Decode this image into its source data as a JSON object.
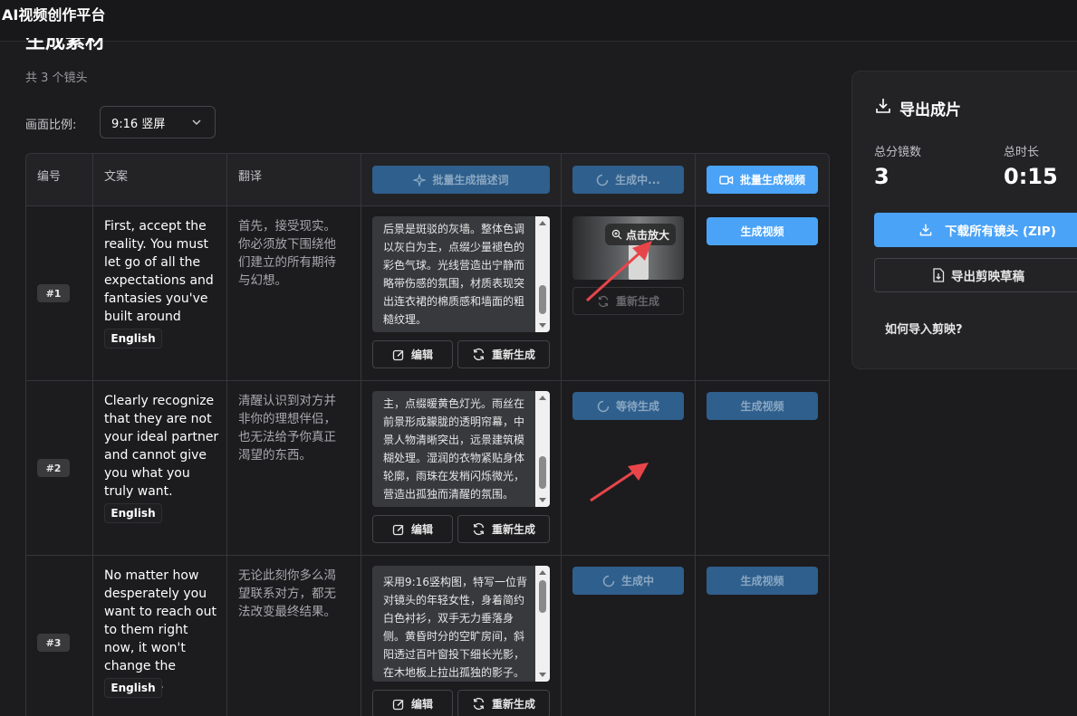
{
  "app": {
    "title": "AI视频创作平台"
  },
  "page": {
    "title": "生成素材",
    "shot_count": "共 3 个镜头"
  },
  "ratio": {
    "label": "画面比例:",
    "value": "9:16 竖屏"
  },
  "table": {
    "headers": {
      "number": "编号",
      "script": "文案",
      "translation": "翻译"
    },
    "batch_prompt_label": "批量生成描述词",
    "batch_generating_label": "生成中...",
    "batch_video_label": "批量生成视频",
    "edit_label": "编辑",
    "regenerate_label": "重新生成",
    "rows": [
      {
        "id": "#1",
        "english": "First, accept the reality. You must let go of all the expectations and fantasies you've built around them.",
        "lang": "English",
        "chinese": "首先，接受现实。你必须放下围绕他们建立的所有期待与幻想。",
        "prompt": "后景是斑驳的灰墙。整体色调以灰白为主，点缀少量褪色的彩色气球。光线营造出宁静而略带伤感的氛围，材质表现突出连衣裙的棉质感和墙面的粗糙纹理。",
        "image_status": "重新生成",
        "zoom_label": "点击放大",
        "video_label": "生成视频"
      },
      {
        "id": "#2",
        "english": "Clearly recognize that they are not your ideal partner and cannot give you what you truly want.",
        "lang": "English",
        "chinese": "清醒认识到对方并非你的理想伴侣，也无法给予你真正渴望的东西。",
        "prompt": "主，点缀暖黄色灯光。雨丝在前景形成朦胧的透明帘幕，中景人物清晰突出，远景建筑模糊处理。湿润的衣物紧贴身体轮廓，雨珠在发梢闪烁微光，营造出孤独而清醒的氛围。",
        "image_status": "等待生成",
        "video_label": "生成视频"
      },
      {
        "id": "#3",
        "english": "No matter how desperately you want to reach out to them right now, it won't change the outcome.",
        "lang": "English",
        "chinese": "无论此刻你多么渴望联系对方，都无法改变最终结果。",
        "prompt": "采用9:16竖构图，特写一位背对镜头的年轻女性，身着简约白色衬衫，双手无力垂落身侧。黄昏时分的空旷房间，斜阳透过百叶窗投下细长光影，在木地板上拉出孤独的影子。",
        "image_status": "生成中",
        "video_label": "生成视频"
      }
    ]
  },
  "export": {
    "title": "导出成片",
    "total_shots_label": "总分镜数",
    "total_shots": "3",
    "duration_label": "总时长",
    "duration": "0:15",
    "download_label": "下载所有镜头 (ZIP)",
    "draft_label": "导出剪映草稿",
    "howto_label": "如何导入剪映?"
  },
  "colors": {
    "accent": "#4aa3f7",
    "accent_dim": "#2f5f8c",
    "annotation": "#e8454a"
  }
}
